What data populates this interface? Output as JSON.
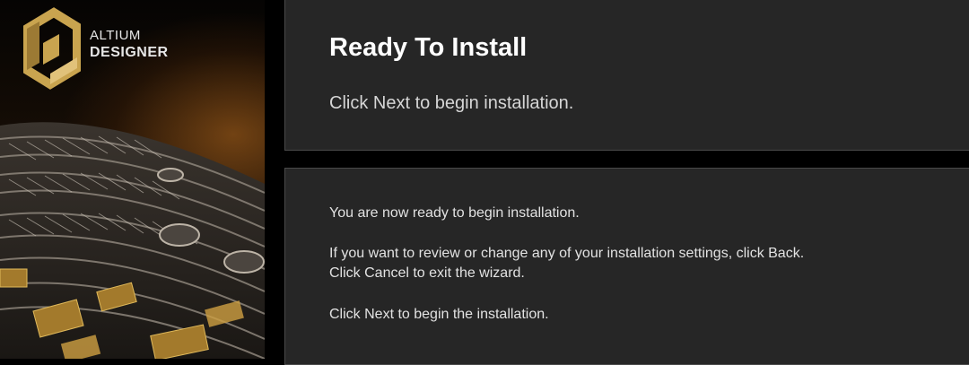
{
  "brand": {
    "line1": "ALTIUM",
    "line2": "DESIGNER",
    "logo_color": "#c9a44f"
  },
  "header": {
    "title": "Ready To Install",
    "subtitle": "Click Next to begin installation."
  },
  "body": {
    "p1": "You are now ready to begin installation.",
    "p2_line1": "If you want to review or change any of your installation settings, click Back.",
    "p2_line2": "Click Cancel to exit the wizard.",
    "p3": "Click Next to begin the installation."
  },
  "colors": {
    "panel_bg": "#262626",
    "panel_border": "#4a4a4a",
    "window_bg": "#000000",
    "accent_gold": "#c9a44f"
  }
}
